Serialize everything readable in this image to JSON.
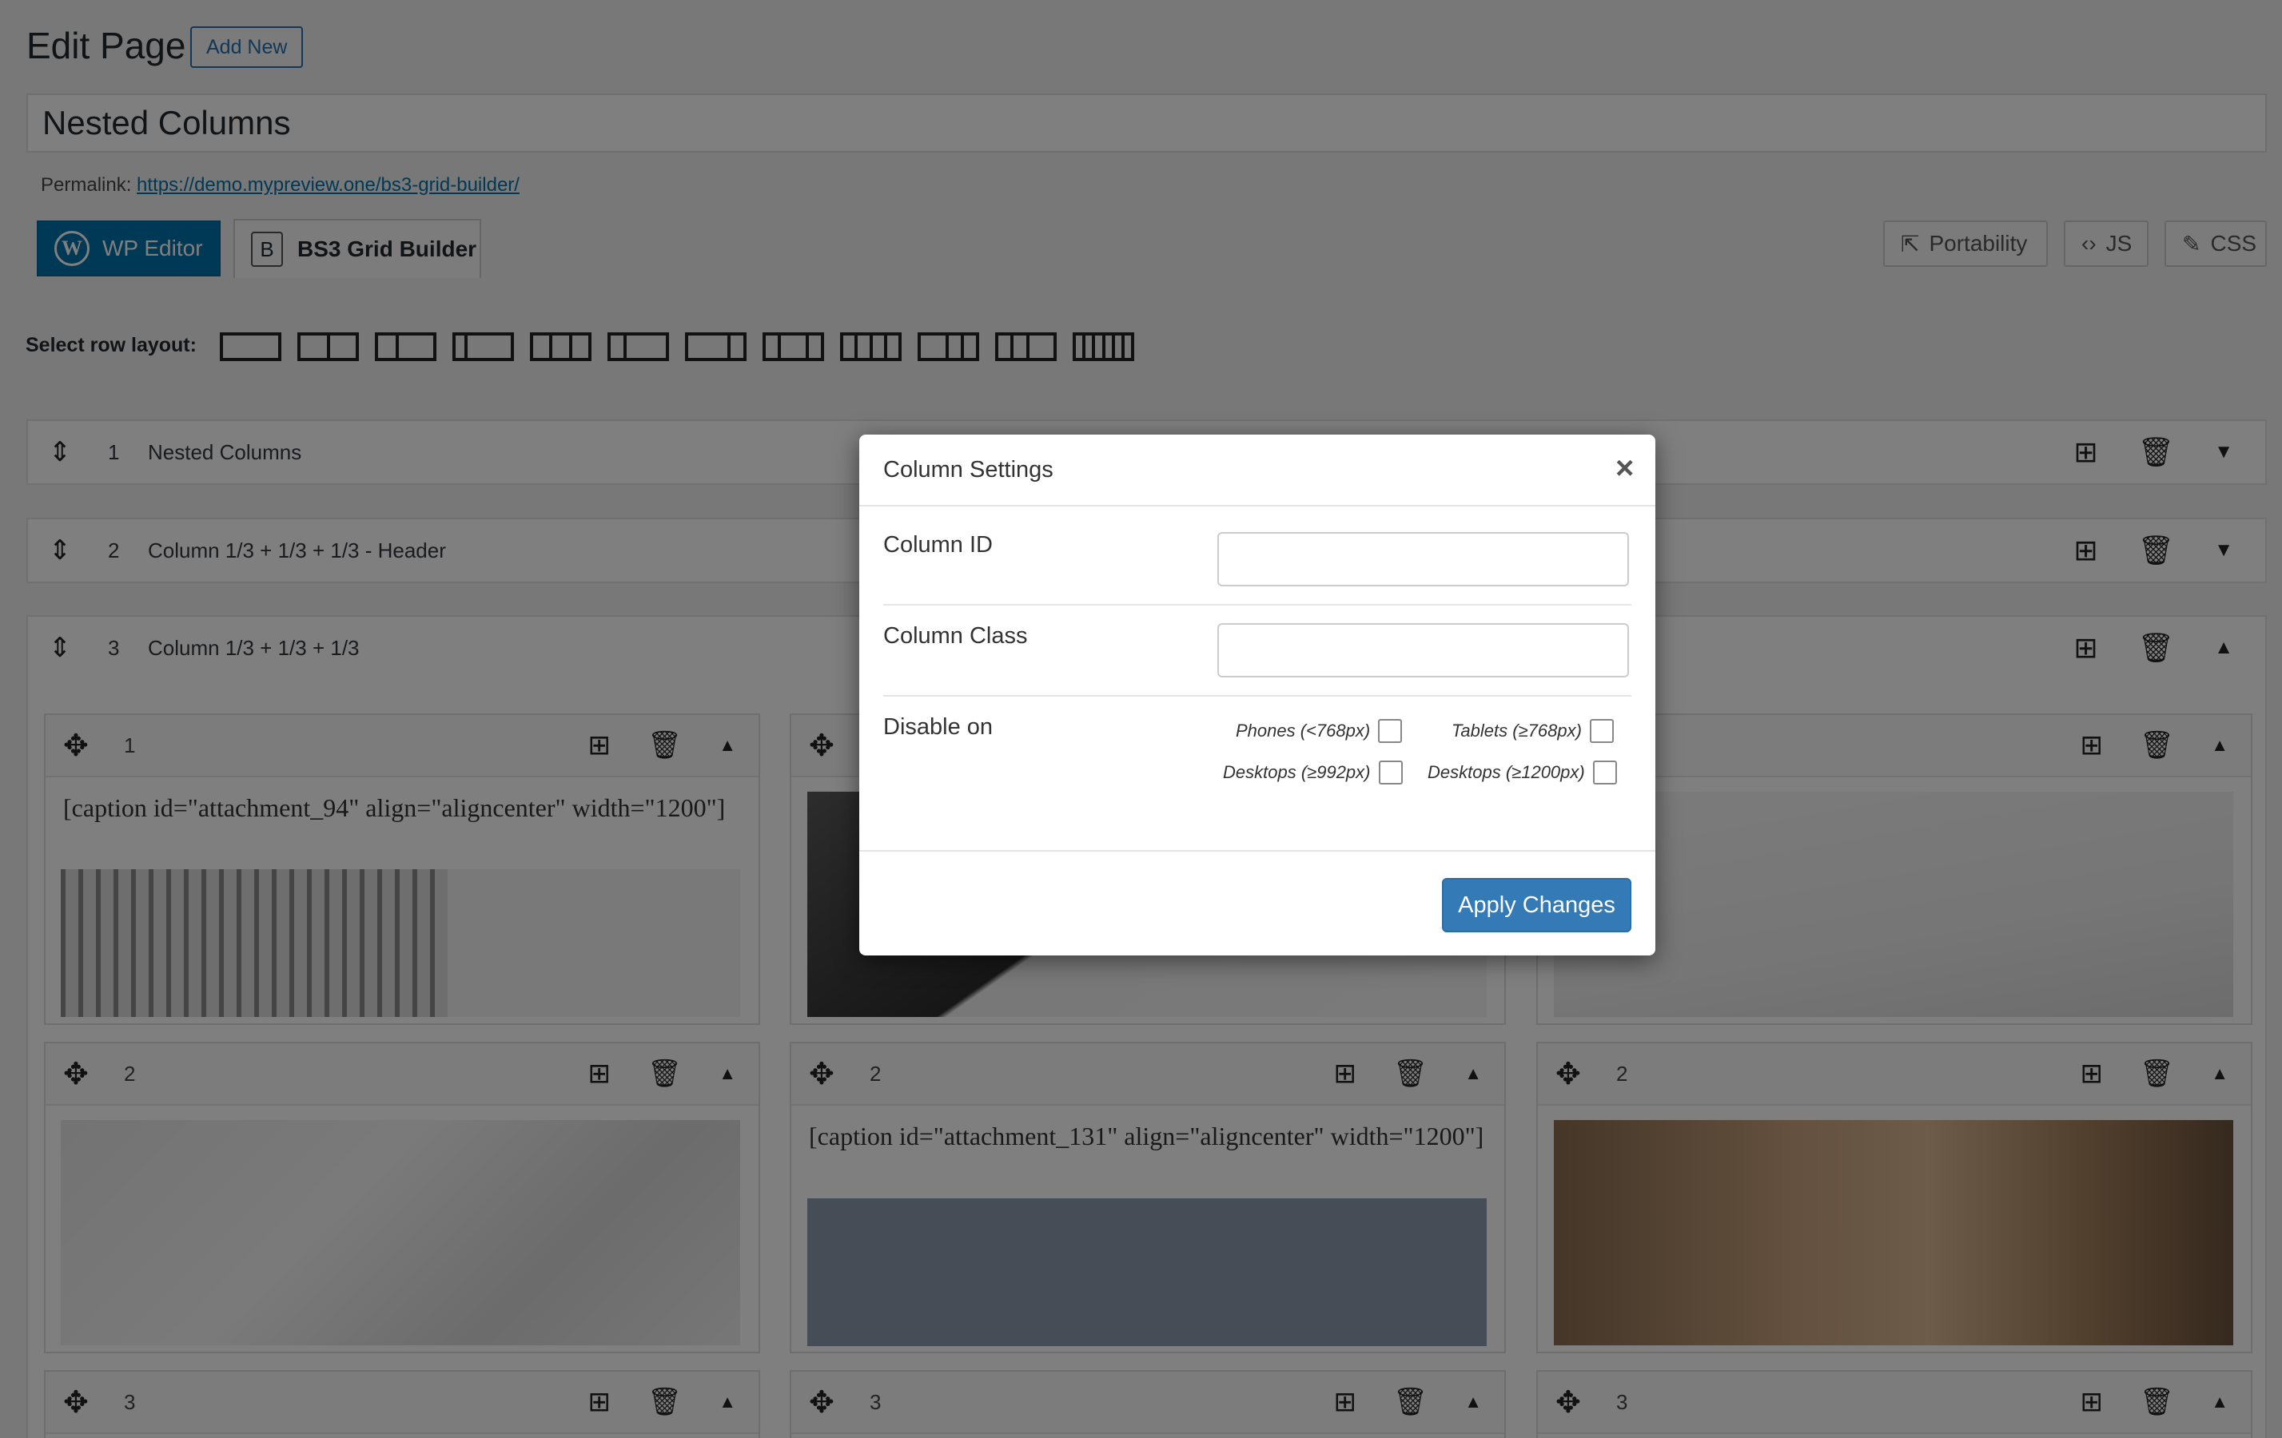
{
  "header": {
    "title": "Edit Page",
    "add_new": "Add New",
    "post_title": "Nested Columns",
    "permalink_label": "Permalink:",
    "permalink_url": "https://demo.mypreview.one/bs3-grid-builder/"
  },
  "editor_tabs": {
    "wp_editor": "WP Editor",
    "bs3_grid_builder": "BS3 Grid Builder",
    "bs3_icon_letter": "B",
    "wp_icon_letter": "W"
  },
  "tools": {
    "portability": "Portability",
    "js": "JS",
    "css": "CSS"
  },
  "layout_selector": {
    "label": "Select row layout:"
  },
  "rows": [
    {
      "number": "1",
      "title": "Nested Columns",
      "toggle": "▼"
    },
    {
      "number": "2",
      "title": "Column 1/3 + 1/3 + 1/3 - Header",
      "toggle": "▼"
    },
    {
      "number": "3",
      "title": "Column 1/3 + 1/3 + 1/3",
      "toggle": "▲"
    }
  ],
  "columns": {
    "col1": {
      "blocks": [
        {
          "number": "1",
          "caption": "[caption id=\"attachment_94\" align=\"aligncenter\" width=\"1200\"]"
        },
        {
          "number": "2"
        },
        {
          "number": "3"
        }
      ]
    },
    "col2": {
      "blocks": [
        {
          "number": "2",
          "caption": "[caption id=\"attachment_131\" align=\"aligncenter\" width=\"1200\"]"
        },
        {
          "number": "3"
        }
      ]
    },
    "col3": {
      "blocks": [
        {
          "number": "2"
        },
        {
          "number": "3"
        }
      ]
    }
  },
  "modal": {
    "title": "Column Settings",
    "close": "×",
    "column_id_label": "Column ID",
    "column_id_value": "",
    "column_class_label": "Column Class",
    "column_class_value": "",
    "disable_on_label": "Disable on",
    "phones": "Phones (<768px)",
    "tablets": "Tablets (≥768px)",
    "desktops_992": "Desktops (≥992px)",
    "desktops_1200": "Desktops (≥1200px)",
    "apply": "Apply Changes"
  },
  "colors": {
    "wp_blue": "#0073aa",
    "apply_button": "#337ab7",
    "overlay": "rgba(0,0,0,0.5)"
  }
}
